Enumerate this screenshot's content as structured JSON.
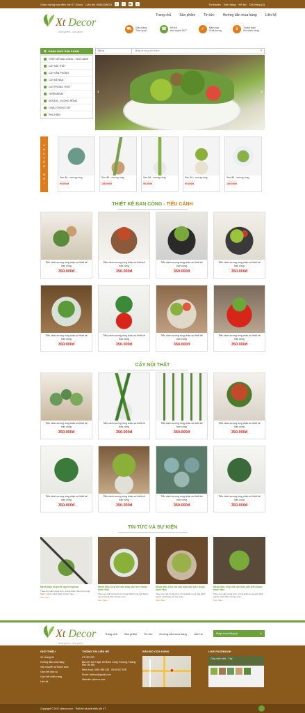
{
  "topbar": {
    "welcome": "Chào mừng bạn đến với XT Decor",
    "hotline": "Liên hệ: 0946226670",
    "login": "Tài khoản",
    "cart_text": "Đơn hàng",
    "checkout": "Hỗ trợ",
    "cart_count": "Giỏ hàng (0)"
  },
  "logo": {
    "brand_x": "Xt",
    "brand_rest": "Decor",
    "slogan": "think green - live green"
  },
  "nav": [
    "Trang chủ",
    "Sản phẩm",
    "Tin tức",
    "Hướng dẫn mua hàng",
    "Liên hệ"
  ],
  "features": [
    {
      "title": "Giao hàng",
      "sub": "Toàn quốc",
      "icon": "truck-icon"
    },
    {
      "title": "Hỗ trợ",
      "sub": "trực tuyến 24/7",
      "icon": "headset-icon"
    },
    {
      "title": "Đảm bảo",
      "sub": "Chất lượng",
      "icon": "check-icon"
    },
    {
      "title": "Thanh toán",
      "sub": "Khi nhận hàng",
      "icon": "cash-icon"
    }
  ],
  "category_header": "DANH MỤC SẢN PHẨM",
  "search": {
    "select": "Tất cả",
    "placeholder": "Nhập từ khóa tìm kiếm"
  },
  "categories": [
    "THIẾT KẾ BAN CÔNG - TIỂU CẢNH",
    "CÂY NỘI THẤT",
    "CÂY VĂN PHÒNG",
    "CÂY ĐỂ BÀN",
    "CÂY PHONG THỦY",
    "TERRARIUM",
    "SEN ĐÁ - XƯƠNG RỒNG",
    "CHẬU TRỒNG CÂY",
    "PHỤ KIỆN"
  ],
  "sale_label": "KHUYẾN MÃI",
  "sale_products": [
    {
      "name": "Sen đá - xương rồng",
      "stars": "☆☆☆☆☆",
      "price": "90.000đ"
    },
    {
      "name": "Sen đá - xương rồng",
      "stars": "☆☆☆☆☆",
      "price": "150.000đ"
    },
    {
      "name": "Sen đá - xương rồng",
      "stars": "☆☆☆☆☆",
      "price": "50.000đ"
    },
    {
      "name": "Sen đá - xương rồng",
      "stars": "☆☆☆☆☆",
      "price": "90.000đ"
    },
    {
      "name": "Sen đá - xương rồng",
      "stars": "☆☆☆☆☆",
      "price": "100.000đ"
    }
  ],
  "section1": {
    "title_a": "THIẾT KẾ BAN CÔNG - ",
    "title_b": "TIỂU CẢNH"
  },
  "section2": {
    "title": "CÂY NỘI THẤT"
  },
  "section3": {
    "title": "TIN TỨC VÀ SỰ KIỆN"
  },
  "products": {
    "name": "Tiểu cảnh xương rồng chậu sứ thiết kế ban công",
    "price": "350.000đ"
  },
  "news": [
    {
      "title": "Mẹnh Mộc hợp với cây trồng nào",
      "desc": "Theo quy luật tương sinh, tương khắc, Mộc trong ngũ hành, người mệnh Mộc sẽ hợp màu...",
      "more": "Xem thêm"
    },
    {
      "title": "Mệnh Mộc hợp với các màu sắc trên thuộc hành Mộc",
      "desc": "Theo quy luật tương sinh, tương khắc trong ngũ hành, người mệnh Mộc sẽ hợp màu...",
      "more": "Xem thêm"
    },
    {
      "title": "Mệnh Mộc hợp với các màu sắc trên thuộc hành Mộc",
      "desc": "Theo quy luật tương sinh, tương khắc trong ngũ hành, người mệnh Mộc sẽ hợp màu...",
      "more": "Xem thêm"
    },
    {
      "title": "Mệnh Mộc hợp với các màu sắc trên thuộc hành Mộc",
      "desc": "Theo quy luật tương sinh, tương khắc trong ngũ hành, người mệnh Mộc sẽ hợp màu...",
      "more": "Xem thêm"
    }
  ],
  "footer_nav": [
    "Trang chủ",
    "Sản phẩm",
    "Tin tức",
    "Hướng dẫn mua hàng",
    "Liên hệ"
  ],
  "newsletter_placeholder": "Nhập email đăng ký",
  "footer": {
    "about_title": "GIỚI THIỆU",
    "about_items": [
      "Về chúng tôi",
      "Hướng dẫn mua hàng",
      "Vận chuyển và thanh toán",
      "Cam kết dịch vụ",
      "Cam kết chất lượng",
      "Liên hệ"
    ],
    "contact_title": "THÔNG TIN LIÊN HỆ",
    "contact_items": [
      "XT DECOR",
      "Địa chỉ: Số 9 Ngõ 199 Đinh Công Thượng, Hoàng Mai, Hà Nội",
      "Điện thoại: 0981 088 228 - 0916 537 628",
      "Email: xtdecor@gmail.com",
      "Website: xtdecor.com"
    ],
    "map_title": "BẢN ĐỒ CỬA HÀNG",
    "fb_title": "LIKE FACEBOOK",
    "fb_page": "Cây cảnh mini - Cây",
    "copyright": "Copyright © 2017 xtdecor.com · Thiết kế và phát triển bởi XT"
  }
}
